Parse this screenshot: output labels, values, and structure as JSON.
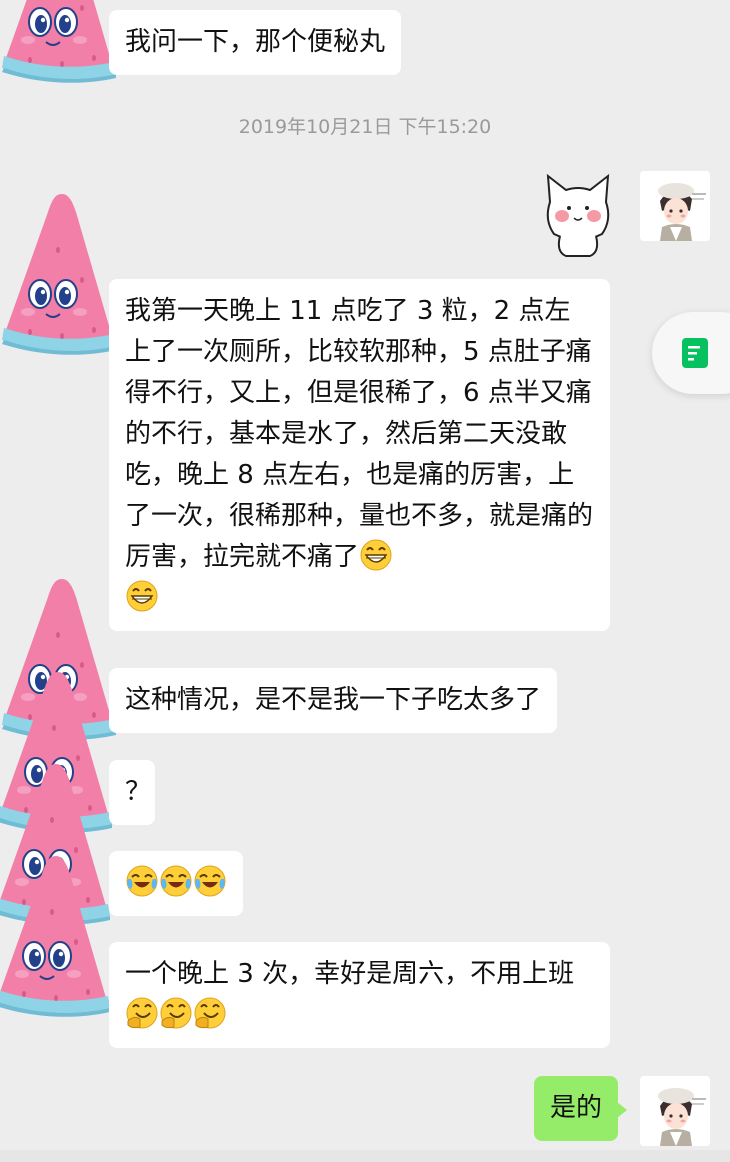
{
  "chat": {
    "timestamp": "2019年10月21日 下午15:20",
    "messages": [
      {
        "sender": "other",
        "text": "我问一下，那个便秘丸"
      },
      {
        "sender": "other",
        "text": "我第一天晚上 11 点吃了 3 粒，2 点左上了一次厕所，比较软那种，5 点肚子痛得不行，又上，但是很稀了，6 点半又痛的不行，基本是水了，然后第二天没敢吃，晚上 8 点左右，也是痛的厉害，上了一次，很稀那种，量也不多，就是痛的厉害，拉完就不痛了",
        "emojis": [
          "grin",
          "grin"
        ]
      },
      {
        "sender": "other",
        "text": "这种情况，是不是我一下子吃太多了"
      },
      {
        "sender": "other",
        "text": "？"
      },
      {
        "sender": "other",
        "emojis": [
          "laugh-cry",
          "laugh-cry",
          "laugh-cry"
        ]
      },
      {
        "sender": "other",
        "text": "一个晚上 3 次，幸好是周六，不用上班",
        "emojis": [
          "thinking-laugh",
          "thinking-laugh",
          "thinking-laugh"
        ]
      },
      {
        "sender": "me",
        "text": "是的"
      }
    ]
  },
  "colors": {
    "background": "#ededed",
    "bubble_other": "#ffffff",
    "bubble_me": "#95ec69",
    "melon_pink": "#f27fa8",
    "melon_rind": "#8ed3e6",
    "accent_green": "#07c160"
  },
  "icons": {
    "other_avatar": "watermelon-avatar",
    "my_avatar": "girl-avatar",
    "sticker": "cat-face-sticker",
    "side_pill": "document-icon"
  }
}
